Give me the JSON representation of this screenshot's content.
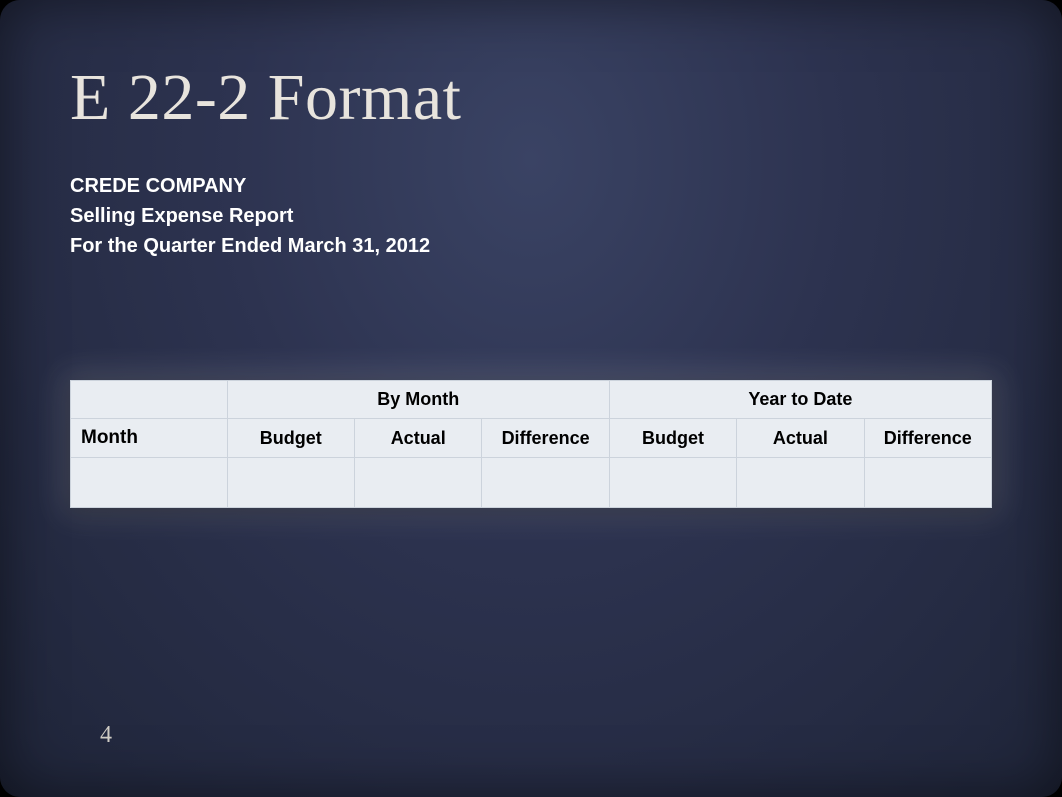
{
  "slide": {
    "title": "E 22-2 Format",
    "pageNumber": "4"
  },
  "report": {
    "company": "CREDE COMPANY",
    "reportName": "Selling Expense  Report",
    "period": "For the Quarter Ended  March 31, 2012"
  },
  "table": {
    "group1": "By Month",
    "group2": "Year to Date",
    "colMonth": "Month",
    "colBudget1": "Budget",
    "colActual1": "Actual",
    "colDiff1": "Difference",
    "colBudget2": "Budget",
    "colActual2": "Actual",
    "colDiff2": "Difference"
  }
}
